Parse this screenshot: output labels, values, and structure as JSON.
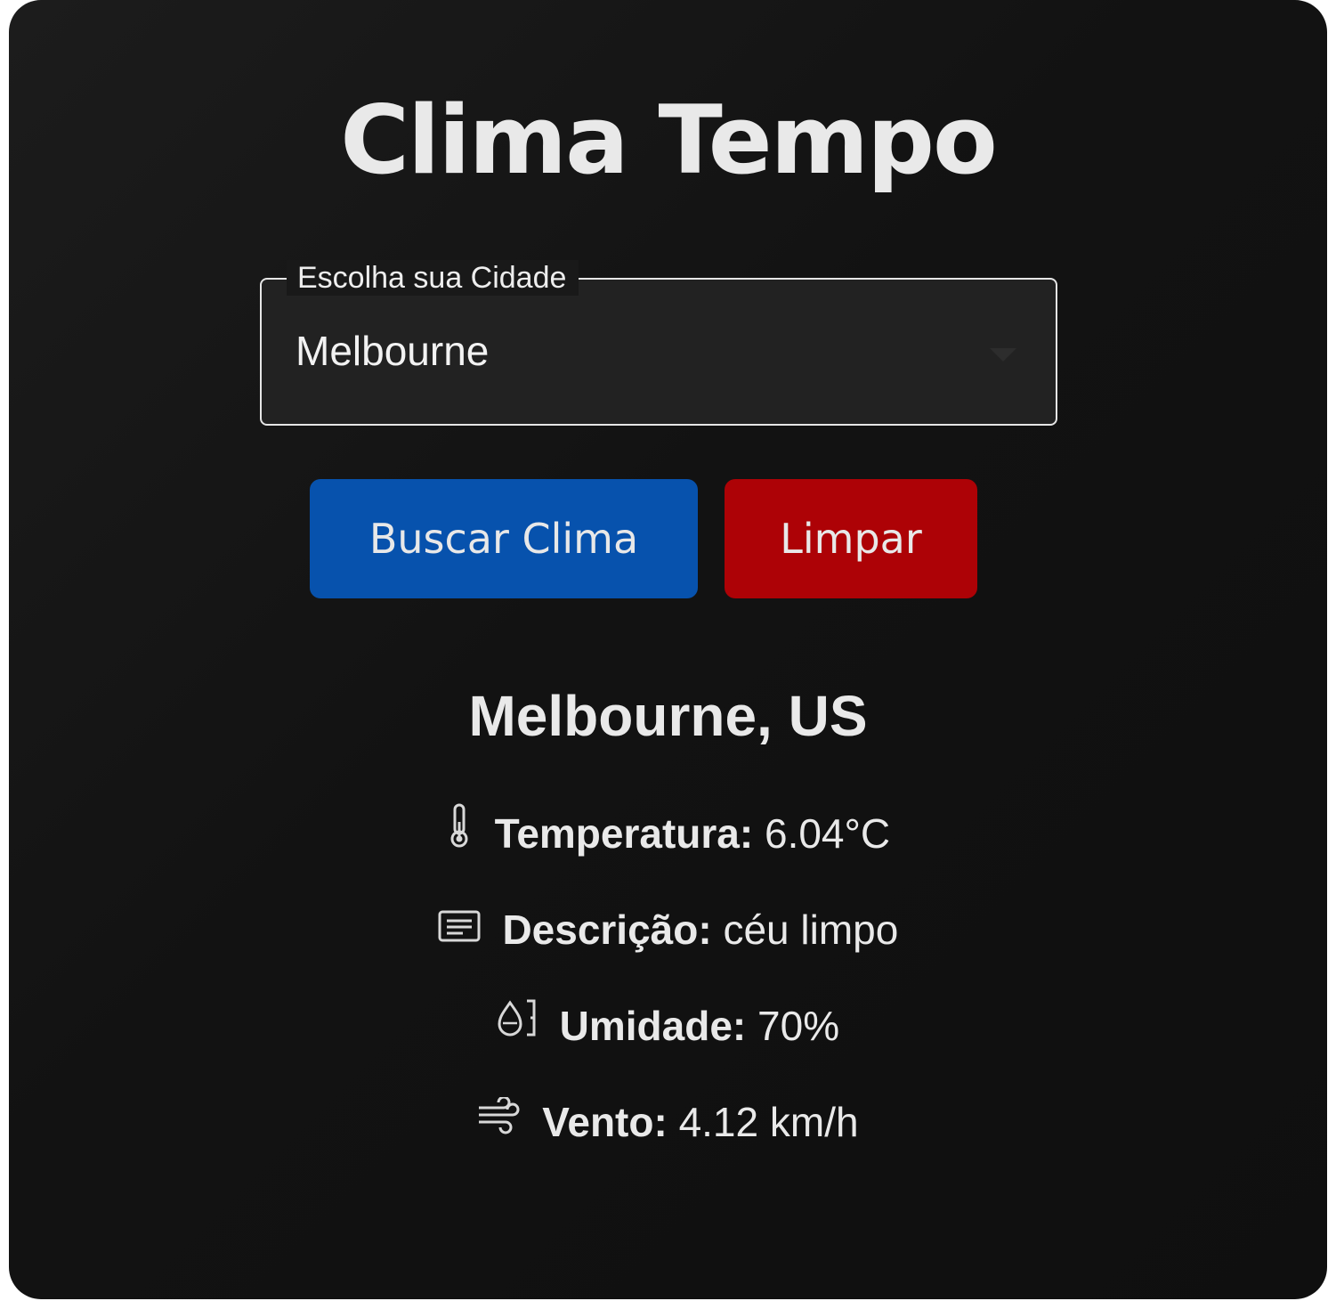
{
  "app": {
    "title": "Clima Tempo"
  },
  "city_select": {
    "label": "Escolha sua Cidade",
    "value": "Melbourne"
  },
  "buttons": {
    "search_label": "Buscar Clima",
    "clear_label": "Limpar"
  },
  "result": {
    "city": "Melbourne, US",
    "temperature": {
      "label": "Temperatura:",
      "value": "6.04°C",
      "icon": "thermometer-icon"
    },
    "description": {
      "label": "Descrição:",
      "value": "céu limpo",
      "icon": "description-icon"
    },
    "humidity": {
      "label": "Umidade:",
      "value": "70%",
      "icon": "humidity-icon"
    },
    "wind": {
      "label": "Vento:",
      "value": "4.12 km/h",
      "icon": "wind-icon"
    }
  },
  "colors": {
    "background": "#121212",
    "search_button": "#0752ad",
    "clear_button": "#ad0206",
    "text": "#e9e9e9"
  }
}
